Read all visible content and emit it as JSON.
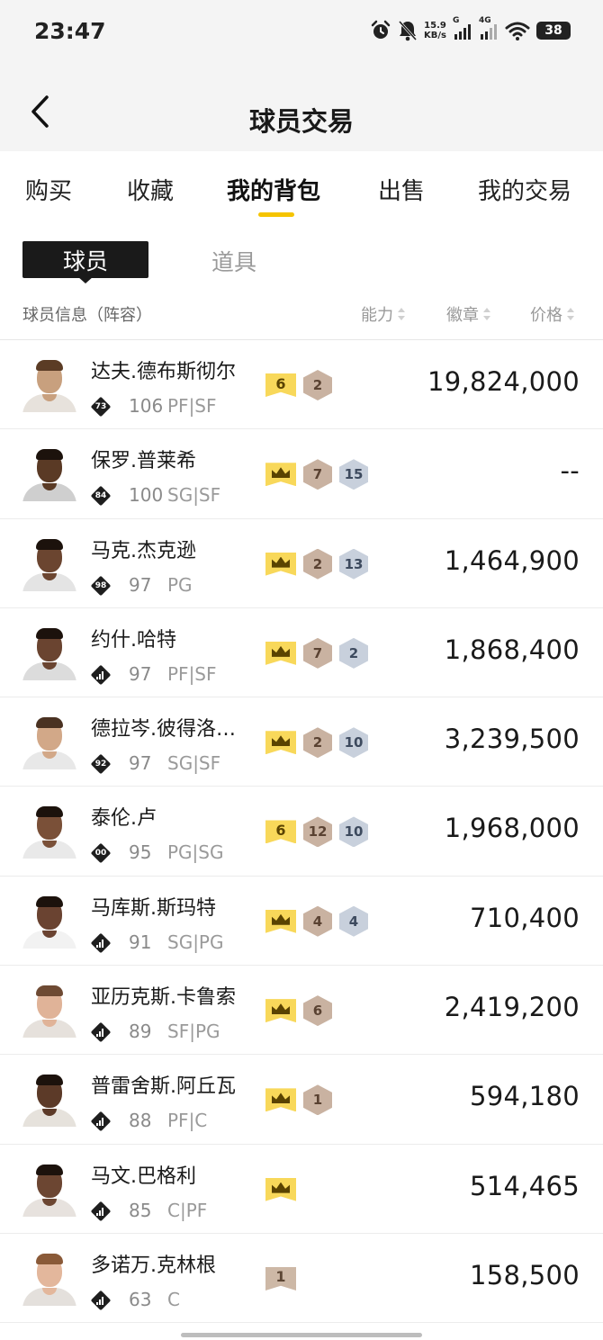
{
  "status_bar": {
    "time": "23:47",
    "net_speed_value": "15.9",
    "net_speed_unit": "KB/s",
    "signal1_tag": "G",
    "signal2_tag": "4G",
    "battery": "38",
    "icons": [
      "alarm-icon",
      "mute-icon",
      "wifi-icon"
    ]
  },
  "header": {
    "title": "球员交易"
  },
  "tabs": [
    {
      "label": "购买"
    },
    {
      "label": "收藏"
    },
    {
      "label": "我的背包",
      "active": true
    },
    {
      "label": "出售"
    },
    {
      "label": "我的交易"
    }
  ],
  "segment": {
    "active": "球员",
    "inactive": "道具"
  },
  "columns": {
    "info": "球员信息（阵容）",
    "ability": "能力",
    "badge": "徽章",
    "price": "价格"
  },
  "players": [
    {
      "name": "达夫.德布斯彻尔",
      "tier": "73",
      "rating": "106",
      "pos": "PF|SF",
      "rank": "6",
      "badges": [
        {
          "v": "2",
          "t": "bronze"
        }
      ],
      "price": "19,824,000"
    },
    {
      "name": "保罗.普莱希",
      "tier": "84",
      "rating": "100",
      "pos": "SG|SF",
      "rank": "crown",
      "badges": [
        {
          "v": "7",
          "t": "bronze"
        },
        {
          "v": "15",
          "t": "silver"
        }
      ],
      "price": "--"
    },
    {
      "name": "马克.杰克逊",
      "tier": "98",
      "rating": "97",
      "pos": "PG",
      "rank": "crown",
      "badges": [
        {
          "v": "2",
          "t": "bronze"
        },
        {
          "v": "13",
          "t": "silver"
        }
      ],
      "price": "1,464,900"
    },
    {
      "name": "约什.哈特",
      "tier": "bars",
      "rating": "97",
      "pos": "PF|SF",
      "rank": "crown",
      "badges": [
        {
          "v": "7",
          "t": "bronze"
        },
        {
          "v": "2",
          "t": "silver"
        }
      ],
      "price": "1,868,400"
    },
    {
      "name": "德拉岑.彼得洛…",
      "tier": "92",
      "rating": "97",
      "pos": "SG|SF",
      "rank": "crown",
      "badges": [
        {
          "v": "2",
          "t": "bronze"
        },
        {
          "v": "10",
          "t": "silver"
        }
      ],
      "price": "3,239,500"
    },
    {
      "name": "泰伦.卢",
      "tier": "00",
      "rating": "95",
      "pos": "PG|SG",
      "rank": "6",
      "badges": [
        {
          "v": "12",
          "t": "bronze"
        },
        {
          "v": "10",
          "t": "silver"
        }
      ],
      "price": "1,968,000"
    },
    {
      "name": "马库斯.斯玛特",
      "tier": "bars",
      "rating": "91",
      "pos": "SG|PG",
      "rank": "crown",
      "badges": [
        {
          "v": "4",
          "t": "bronze"
        },
        {
          "v": "4",
          "t": "silver"
        }
      ],
      "price": "710,400"
    },
    {
      "name": "亚历克斯.卡鲁索",
      "tier": "bars",
      "rating": "89",
      "pos": "SF|PG",
      "rank": "crown",
      "badges": [
        {
          "v": "6",
          "t": "bronze"
        }
      ],
      "price": "2,419,200"
    },
    {
      "name": "普雷舍斯.阿丘瓦",
      "tier": "bars",
      "rating": "88",
      "pos": "PF|C",
      "rank": "crown",
      "badges": [
        {
          "v": "1",
          "t": "bronze"
        }
      ],
      "price": "594,180"
    },
    {
      "name": "马文.巴格利",
      "tier": "bars",
      "rating": "85",
      "pos": "C|PF",
      "rank": "crown",
      "badges": [],
      "price": "514,465"
    },
    {
      "name": "多诺万.克林根",
      "tier": "bars",
      "rating": "63",
      "pos": "C",
      "rank": "1",
      "rank_style": "bronze",
      "badges": [],
      "price": "158,500"
    }
  ]
}
